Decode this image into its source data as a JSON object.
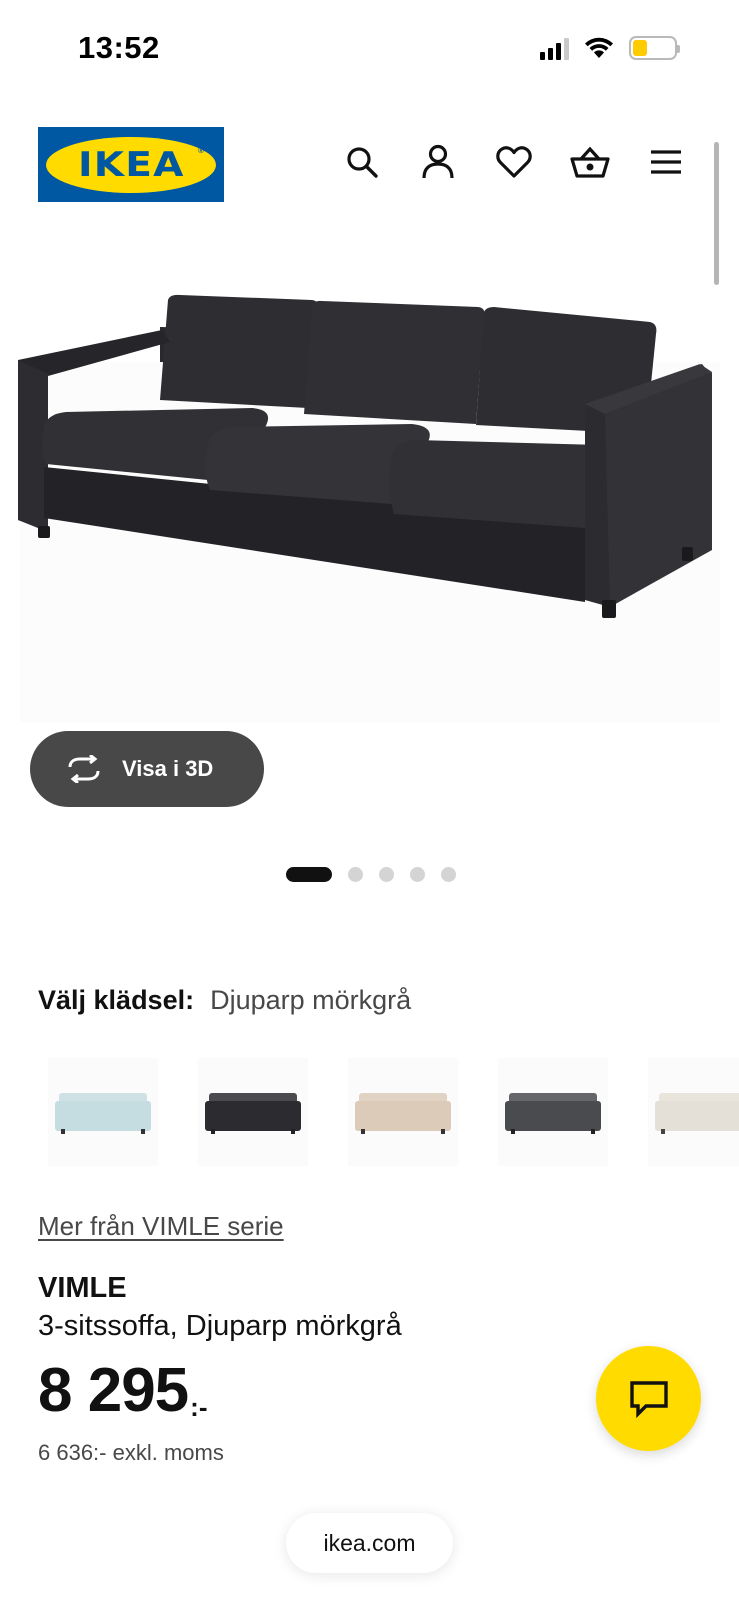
{
  "status_bar": {
    "time": "13:52",
    "icons": [
      "cellular-signal-icon",
      "wifi-icon",
      "battery-icon"
    ],
    "battery_level": 0.36
  },
  "header": {
    "logo_text": "IKEA",
    "icons": [
      "search-icon",
      "account-icon",
      "heart-icon",
      "basket-icon",
      "menu-icon"
    ]
  },
  "product_image": {
    "alt_icon": "sofa-image",
    "view_3d_label": "Visa i 3D",
    "carousel": {
      "total": 5,
      "active": 1
    }
  },
  "fabric": {
    "label": "Välj klädsel:",
    "selected": "Djuparp mörkgrå",
    "swatch_colors": [
      "#c5dde0",
      "#2b2b30",
      "#dccbb8",
      "#4a4b4f",
      "#e5e0d7"
    ]
  },
  "series_link": "Mer från VIMLE serie",
  "product": {
    "name": "VIMLE",
    "description": "3-sitssoffa, Djuparp mörkgrå",
    "price": "8 295",
    "price_suffix": ":-",
    "price_excl_vat": "6 636:- exkl. moms"
  },
  "chat": {
    "icon": "chat-icon"
  },
  "browser": {
    "url": "ikea.com"
  },
  "colors": {
    "brand_blue": "#0058a3",
    "brand_yellow": "#ffdb00",
    "button_dark": "#484848"
  }
}
